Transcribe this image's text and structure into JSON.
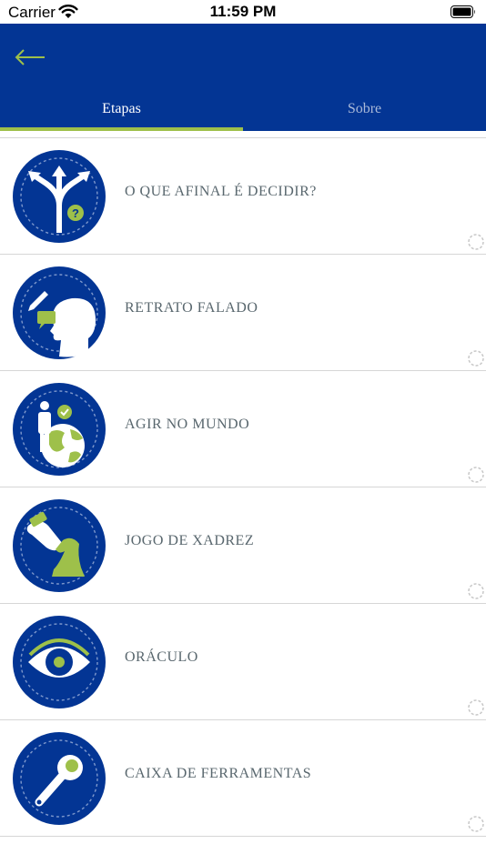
{
  "status_bar": {
    "carrier": "Carrier",
    "time": "11:59 PM"
  },
  "header": {
    "tabs": [
      {
        "label": "Etapas",
        "selected": true
      },
      {
        "label": "Sobre",
        "selected": false
      }
    ]
  },
  "colors": {
    "primary": "#033594",
    "accent": "#9ec04a",
    "label": "#59676e",
    "divider": "#d6d6d6"
  },
  "items": [
    {
      "label": "O QUE AFINAL É DECIDIR?",
      "icon": "crossroads-arrows-icon"
    },
    {
      "label": "RETRATO FALADO",
      "icon": "head-profile-pencil-icon"
    },
    {
      "label": "AGIR NO MUNDO",
      "icon": "person-globe-icon"
    },
    {
      "label": "JOGO DE XADREZ",
      "icon": "chess-knight-icon"
    },
    {
      "label": "ORÁCULO",
      "icon": "eye-icon"
    },
    {
      "label": "CAIXA DE FERRAMENTAS",
      "icon": "wrench-icon"
    }
  ]
}
